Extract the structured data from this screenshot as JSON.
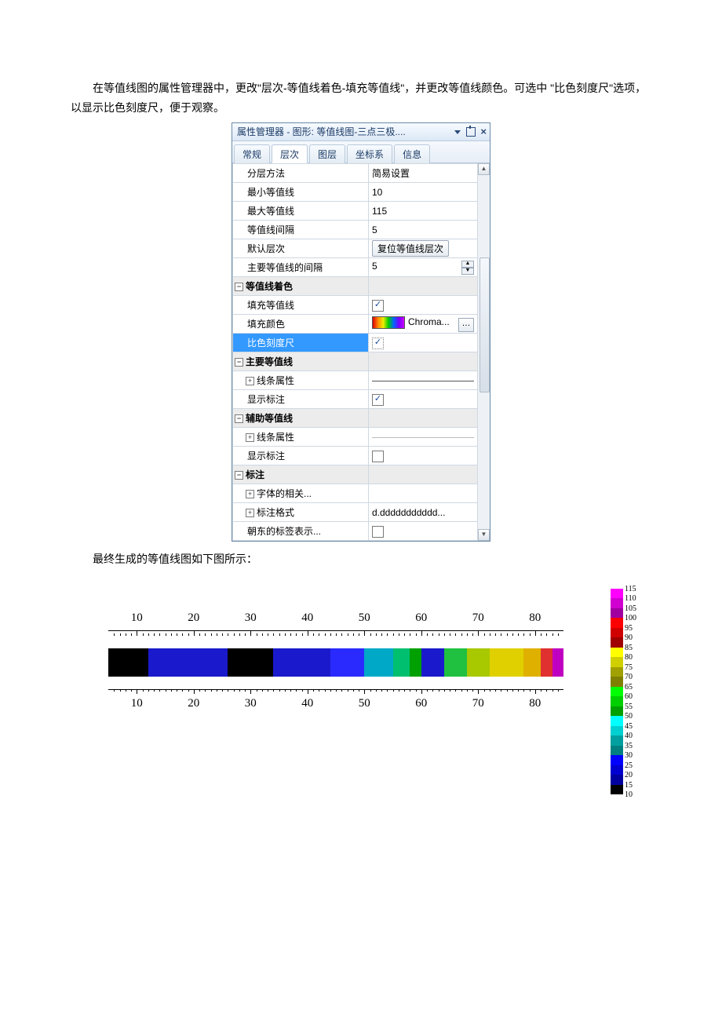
{
  "text": {
    "para1": "在等值线图的属性管理器中，更改\"层次-等值线着色-填充等值线\"，并更改等值线颜色。可选中 \"比色刻度尺\"选项，以显示比色刻度尺，便于观察。",
    "para2": "最终生成的等值线图如下图所示："
  },
  "panel": {
    "title": "属性管理器 - 图形: 等值线图-三点三极....",
    "tabs": [
      "常规",
      "层次",
      "图层",
      "坐标系",
      "信息"
    ],
    "active_tab": 1,
    "rows": {
      "layer_method_lbl": "分层方法",
      "layer_method_val": "简易设置",
      "min_lbl": "最小等值线",
      "min_val": "10",
      "max_lbl": "最大等值线",
      "max_val": "115",
      "interval_lbl": "等值线间隔",
      "interval_val": "5",
      "default_lbl": "默认层次",
      "default_btn": "复位等值线层次",
      "major_int_lbl": "主要等值线的间隔",
      "major_int_val": "5",
      "sec_color_lbl": "等值线着色",
      "fill_contour_lbl": "填充等值线",
      "fill_color_lbl": "填充颜色",
      "fill_color_val": "Chroma...",
      "scale_lbl": "比色刻度尺",
      "sec_major_lbl": "主要等值线",
      "line_prop_lbl": "线条属性",
      "show_label_lbl": "显示标注",
      "sec_aux_lbl": "辅助等值线",
      "sec_label_lbl": "标注",
      "font_lbl": "字体的相关...",
      "fmt_lbl": "标注格式",
      "fmt_val": "d.ddddddddddd...",
      "east_lbl": "朝东的标签表示..."
    }
  },
  "chart_data": {
    "type": "heatmap",
    "title": "",
    "xlabel": "",
    "ylabel": "",
    "x_ticks": [
      10,
      20,
      30,
      40,
      50,
      60,
      70,
      80
    ],
    "xlim": [
      5,
      85
    ],
    "segments": [
      {
        "x0": 5,
        "x1": 12,
        "color": "#000000"
      },
      {
        "x0": 12,
        "x1": 26,
        "color": "#1a1acc"
      },
      {
        "x0": 26,
        "x1": 34,
        "color": "#000000"
      },
      {
        "x0": 34,
        "x1": 44,
        "color": "#1a1acc"
      },
      {
        "x0": 44,
        "x1": 50,
        "color": "#2a2aff"
      },
      {
        "x0": 50,
        "x1": 55,
        "color": "#00a8c8"
      },
      {
        "x0": 55,
        "x1": 58,
        "color": "#00c070"
      },
      {
        "x0": 58,
        "x1": 60,
        "color": "#00a000"
      },
      {
        "x0": 60,
        "x1": 64,
        "color": "#1a1acc"
      },
      {
        "x0": 64,
        "x1": 68,
        "color": "#20c040"
      },
      {
        "x0": 68,
        "x1": 72,
        "color": "#a8c800"
      },
      {
        "x0": 72,
        "x1": 78,
        "color": "#e0d000"
      },
      {
        "x0": 78,
        "x1": 81,
        "color": "#e0b000"
      },
      {
        "x0": 81,
        "x1": 83,
        "color": "#e03030"
      },
      {
        "x0": 83,
        "x1": 85,
        "color": "#c000c0"
      }
    ],
    "legend": {
      "values": [
        115,
        110,
        105,
        100,
        95,
        90,
        85,
        80,
        75,
        70,
        65,
        60,
        55,
        50,
        45,
        40,
        35,
        30,
        25,
        20,
        15,
        10
      ],
      "colors": [
        "#ff00ff",
        "#d000d0",
        "#a000a0",
        "#ff0000",
        "#d00000",
        "#a00000",
        "#ffff00",
        "#d0d000",
        "#a0a000",
        "#808000",
        "#00ff00",
        "#00d000",
        "#00a000",
        "#00ffff",
        "#00d0d0",
        "#00a0a0",
        "#008080",
        "#0000ff",
        "#0000d0",
        "#0000a0",
        "#000000"
      ]
    }
  }
}
